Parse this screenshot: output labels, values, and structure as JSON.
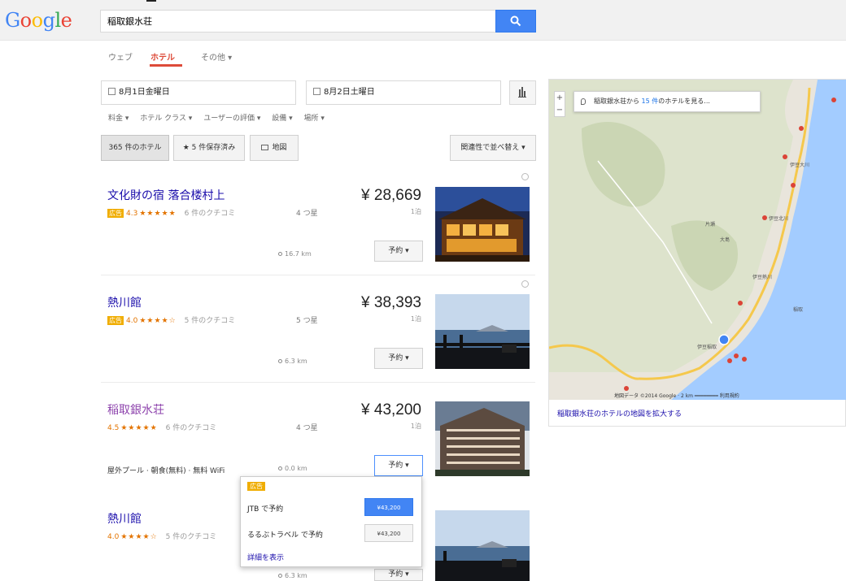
{
  "brand": {
    "logo_text": "Google",
    "colors": [
      "#4285f4",
      "#ea4335",
      "#fbbc05",
      "#4285f4",
      "#34a853",
      "#ea4335"
    ]
  },
  "search": {
    "query": "稲取銀水荘",
    "button_icon": "search-icon"
  },
  "tabs": [
    {
      "label": "ウェブ",
      "active": false
    },
    {
      "label": "ホテル",
      "active": true
    },
    {
      "label": "その他 ▾",
      "active": false
    }
  ],
  "dates": {
    "checkin": "8月1日金曜日",
    "checkout": "8月2日土曜日",
    "graph_icon": "bar-chart-icon"
  },
  "filters": [
    "料金 ▾",
    "ホテル クラス ▾",
    "ユーザーの評価 ▾",
    "設備 ▾",
    "場所 ▾"
  ],
  "pills": {
    "all_hotels": "365 件のホテル",
    "saved": "★ 5 件保存済み",
    "map": "地図",
    "sort": "関連性で並べ替え ▾"
  },
  "hotels": [
    {
      "name": "文化財の宿 落合楼村上",
      "ad": "広告",
      "score": "4.3",
      "stars": "★★★★★",
      "reviews": "6 件のクチコミ",
      "class": "4 つ星",
      "price": "¥ 28,669",
      "nights": "1泊",
      "distance": "16.7 km",
      "book": "予約 ▾"
    },
    {
      "name": "熱川館",
      "ad": "広告",
      "score": "4.0",
      "stars": "★★★★☆",
      "reviews": "5 件のクチコミ",
      "class": "5 つ星",
      "price": "¥ 38,393",
      "nights": "1泊",
      "distance": "6.3 km",
      "book": "予約 ▾"
    },
    {
      "name": "稲取銀水荘",
      "ad": "",
      "score": "4.5",
      "stars": "★★★★★",
      "reviews": "6 件のクチコミ",
      "class": "4 つ星",
      "price": "¥ 43,200",
      "nights": "1泊",
      "distance": "0.0 km",
      "amenities": "屋外プール · 朝食(無料) · 無料 WiFi",
      "book": "予約 ▾"
    },
    {
      "name": "熱川館",
      "ad": "",
      "score": "4.0",
      "stars": "★★★★☆",
      "reviews": "5 件のクチコミ",
      "class": "5 つ星",
      "price": "",
      "nights": "",
      "distance": "6.3 km",
      "book": "予約 ▾"
    }
  ],
  "dropdown": {
    "ad": "広告",
    "offers": [
      {
        "label": "JTB で予約",
        "price": "¥43,200"
      },
      {
        "label": "るるぶトラベル で予約",
        "price": "¥43,200"
      }
    ],
    "more": "詳細を表示"
  },
  "map": {
    "search_prefix": "稲取銀水荘から",
    "search_count": "15 件",
    "search_suffix": "のホテルを見る...",
    "zoom_in": "+",
    "zoom_out": "−",
    "attribution": "地図データ ©2014 Google · 2 km ━━━━━━━━ 利用規約",
    "expand_link": "稲取銀水荘のホテルの地図を拡大する",
    "labels": [
      "伊豆大川",
      "伊豆北川",
      "伊豆熱川",
      "片瀬",
      "稲取",
      "大島",
      "伊豆稲取"
    ]
  }
}
